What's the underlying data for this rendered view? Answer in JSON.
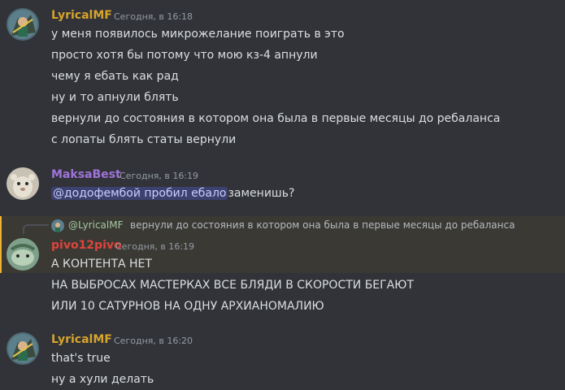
{
  "colors": {
    "background": "#313338",
    "lyrical_name": "#d7a42c",
    "maksa_name": "#a073d9",
    "pivo_name": "#e0443c",
    "reply_name": "#a3c9a0",
    "mention_bg": "#5865f2",
    "highlight_bar": "#f0b232"
  },
  "messages": [
    {
      "username": "LyricalMF",
      "timestamp": "Сегодня, в 16:18",
      "avatar_icon": "avatar-lyricalmf-icon",
      "lines": [
        "у меня появилось микрожелание поиграть в это",
        "просто хотя бы потому что мою кз-4 апнули",
        "чему я ебать как рад",
        "ну и то апнули блять",
        "вернули до состояния в котором она была в первые месяцы до ребаланса",
        "с лопаты блять статы вернули"
      ]
    },
    {
      "username": "MaksaBest",
      "timestamp": "Сегодня, в 16:19",
      "avatar_icon": "avatar-maksabest-icon",
      "mention": "@додофембой пробил ебало",
      "text": "заменишь?"
    },
    {
      "username": "pivo12pivo",
      "timestamp": "Сегодня, в 16:19",
      "avatar_icon": "avatar-pivo12pivo-icon",
      "reply": {
        "username": "@LyricalMF",
        "text": "вернули до состояния в котором она была в первые месяцы до ребаланса"
      },
      "lines": [
        "А КОНТЕНТА НЕТ",
        "НА ВЫБРОСАХ МАСТЕРКАХ ВСЕ БЛЯДИ В СКОРОСТИ БЕГАЮТ",
        "ИЛИ 10 САТУРНОВ НА ОДНУ АРХИАНОМАЛИЮ"
      ]
    },
    {
      "username": "LyricalMF",
      "timestamp": "Сегодня, в 16:20",
      "avatar_icon": "avatar-lyricalmf-icon",
      "lines": [
        "that's true",
        "ну а хули делать"
      ]
    }
  ]
}
